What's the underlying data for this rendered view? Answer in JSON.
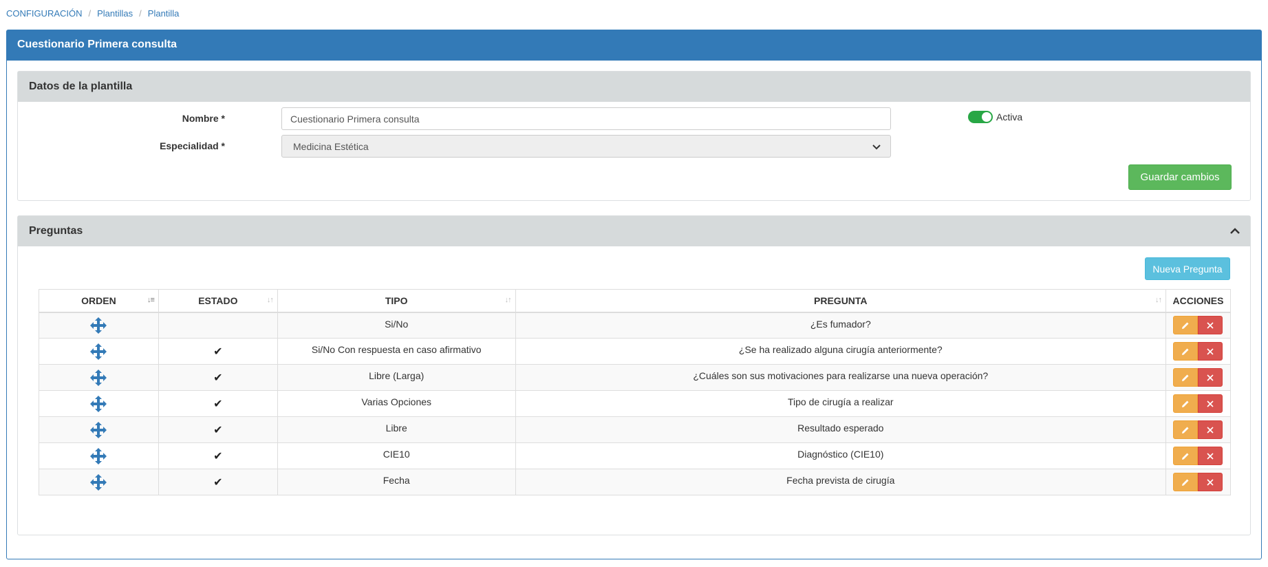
{
  "breadcrumb": [
    "CONFIGURACIÓN",
    "Plantillas",
    "Plantilla"
  ],
  "panel_title": "Cuestionario Primera consulta",
  "datos": {
    "title": "Datos de la plantilla",
    "nombre_label": "Nombre *",
    "nombre_value": "Cuestionario Primera consulta",
    "especialidad_label": "Especialidad *",
    "especialidad_value": "Medicina Estética",
    "activa_label": "Activa",
    "activa_on": true,
    "save_label": "Guardar cambios"
  },
  "preguntas": {
    "title": "Preguntas",
    "new_label": "Nueva Pregunta",
    "columns": [
      "ORDEN",
      "ESTADO",
      "TIPO",
      "PREGUNTA",
      "ACCIONES"
    ],
    "rows": [
      {
        "estado": false,
        "tipo": "Si/No",
        "pregunta": "¿Es fumador?"
      },
      {
        "estado": true,
        "tipo": "Si/No Con respuesta en caso afirmativo",
        "pregunta": "¿Se ha realizado alguna cirugía anteriormente?"
      },
      {
        "estado": true,
        "tipo": "Libre (Larga)",
        "pregunta": "¿Cuáles son sus motivaciones para realizarse una nueva operación?"
      },
      {
        "estado": true,
        "tipo": "Varias Opciones",
        "pregunta": "Tipo de cirugía a realizar"
      },
      {
        "estado": true,
        "tipo": "Libre",
        "pregunta": "Resultado esperado"
      },
      {
        "estado": true,
        "tipo": "CIE10",
        "pregunta": "Diagnóstico (CIE10)"
      },
      {
        "estado": true,
        "tipo": "Fecha",
        "pregunta": "Fecha prevista de cirugía"
      }
    ]
  },
  "icons": {
    "move": "move-arrows-icon",
    "check": "checkmark-icon",
    "edit": "pencil-icon",
    "delete": "close-icon",
    "collapse": "chevron-up-icon",
    "dropdown": "chevron-down-icon"
  },
  "colors": {
    "primary": "#337ab7",
    "success": "#5cb85c",
    "info": "#5bc0de",
    "warning": "#f0ad4e",
    "danger": "#d9534f"
  }
}
